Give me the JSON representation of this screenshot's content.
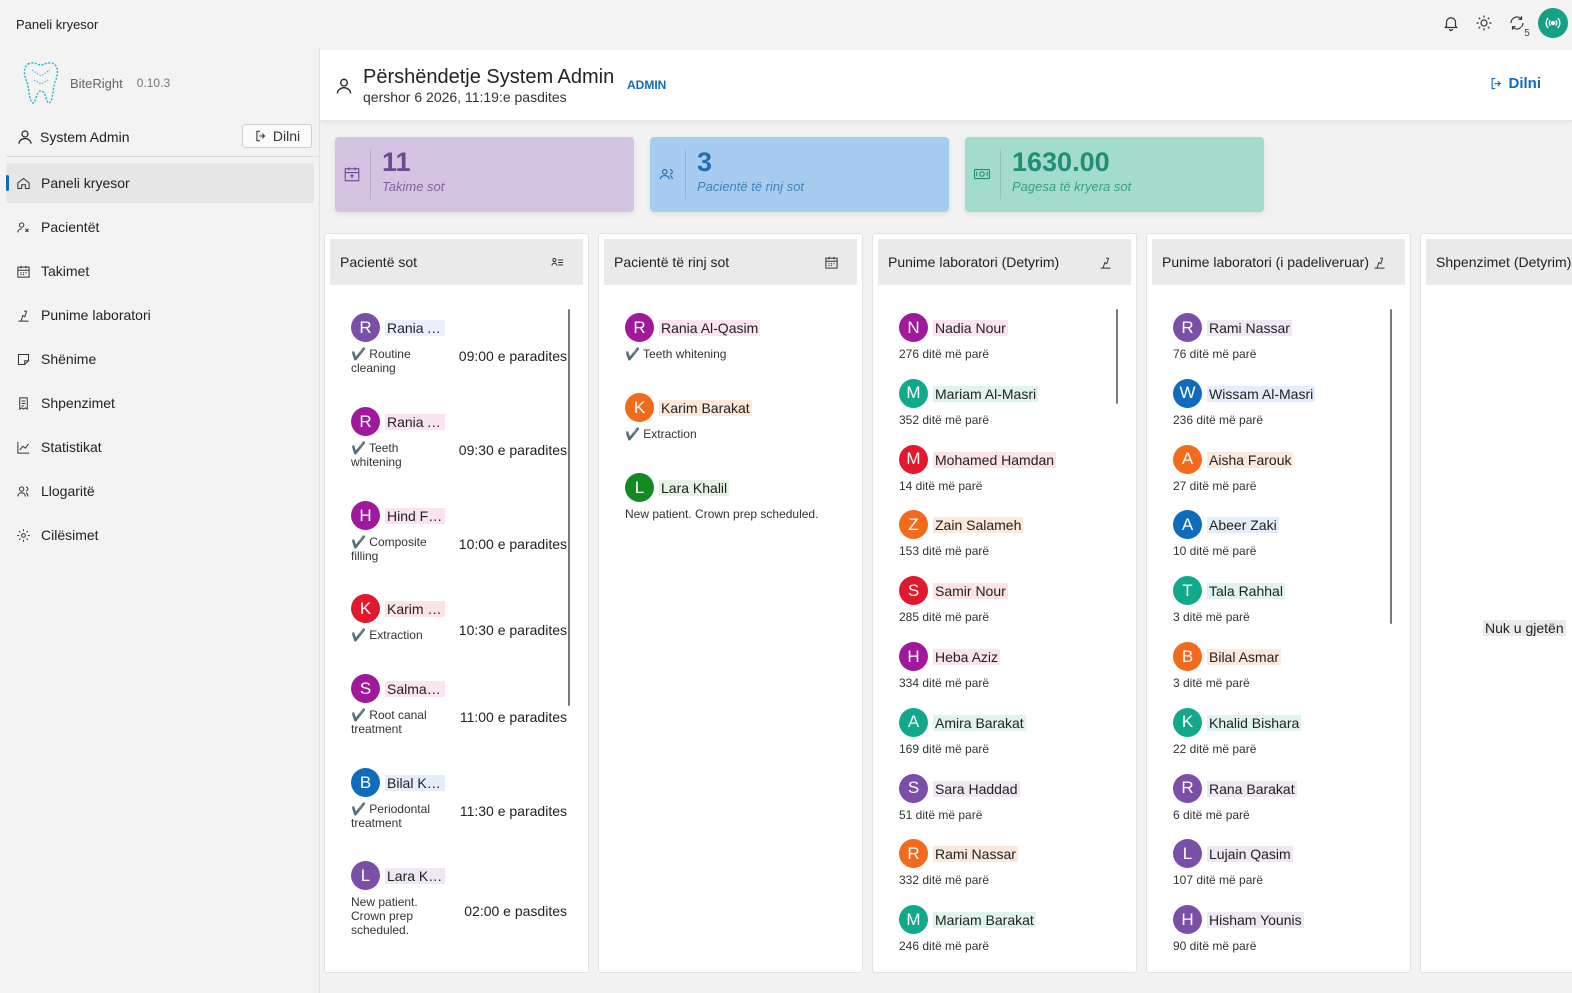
{
  "titlebar": {
    "title": "Paneli kryesor",
    "sync_count": "5"
  },
  "brand": {
    "name": "BiteRight",
    "version": "0.10.3"
  },
  "user": {
    "name": "System Admin",
    "logout_label": "Dilni"
  },
  "nav": [
    {
      "label": "Paneli kryesor",
      "icon": "home-icon",
      "active": true
    },
    {
      "label": "Pacientët",
      "icon": "patients-icon"
    },
    {
      "label": "Takimet",
      "icon": "calendar-icon"
    },
    {
      "label": "Punime laboratori",
      "icon": "lab-icon"
    },
    {
      "label": "Shënime",
      "icon": "note-icon"
    },
    {
      "label": "Shpenzimet",
      "icon": "receipt-icon"
    },
    {
      "label": "Statistikat",
      "icon": "chart-icon"
    },
    {
      "label": "Llogaritë",
      "icon": "accounts-icon"
    },
    {
      "label": "Cilësimet",
      "icon": "settings-icon"
    }
  ],
  "greeting": {
    "heading": "Përshëndetje System Admin",
    "date": "qershor 6 2026, 11:19:e pasdites",
    "role": "ADMIN",
    "logout_label": "Dilni"
  },
  "stats": [
    {
      "value": "11",
      "label": "Takime sot",
      "bg": "#d4c3e3",
      "fg": "#6b4a8f"
    },
    {
      "value": "3",
      "label": "Pacientë të rinj sot",
      "bg": "#a8ccef",
      "fg": "#1f6fb2"
    },
    {
      "value": "1630.00",
      "label": "Pagesa të kryera sot",
      "bg": "#a3dccd",
      "fg": "#1f8f72"
    }
  ],
  "panels": {
    "today": {
      "title": "Pacientë sot",
      "items": [
        {
          "initial": "R",
          "color": "#7b4fa8",
          "name": "Rania A...",
          "note_lines": [
            "✔️ Routine",
            "cleaning"
          ],
          "time": "09:00 e paradites",
          "hl": "#eaf0ff"
        },
        {
          "initial": "R",
          "color": "#a0189b",
          "name": "Rania Al...",
          "note_lines": [
            "✔️ Teeth",
            "whitening"
          ],
          "time": "09:30 e paradites",
          "hl": "#fbe3ef"
        },
        {
          "initial": "H",
          "color": "#a0189b",
          "name": "Hind Fa...",
          "note_lines": [
            "✔️ Composite",
            "filling"
          ],
          "time": "10:00 e paradites",
          "hl": "#fbe3ef"
        },
        {
          "initial": "K",
          "color": "#e0192e",
          "name": "Karim B...",
          "note_lines": [
            "✔️ Extraction"
          ],
          "time": "10:30 e paradites",
          "hl": "#fde3e3"
        },
        {
          "initial": "S",
          "color": "#a0189b",
          "name": "Salma Y...",
          "note_lines": [
            "✔️ Root canal",
            "treatment"
          ],
          "time": "11:00 e paradites",
          "hl": "#fbe3ef"
        },
        {
          "initial": "B",
          "color": "#0f6cbd",
          "name": "Bilal Kh...",
          "note_lines": [
            "✔️ Periodontal",
            "treatment"
          ],
          "time": "11:30 e paradites",
          "hl": "#e4eefb"
        },
        {
          "initial": "L",
          "color": "#7b4fa8",
          "name": "Lara Khalil",
          "note_lines": [
            "New patient.",
            "Crown prep",
            "scheduled."
          ],
          "time": "02:00 e pasdites",
          "hl": "#eee8f5"
        }
      ]
    },
    "new_today": {
      "title": "Pacientë të rinj sot",
      "items": [
        {
          "initial": "R",
          "color": "#a0189b",
          "name": "Rania Al-Qasim",
          "note": "✔️ Teeth whitening",
          "hl": "#fbe3ef"
        },
        {
          "initial": "K",
          "color": "#f26a1b",
          "name": "Karim Barakat",
          "note": "✔️ Extraction",
          "hl": "#fde8dc"
        },
        {
          "initial": "L",
          "color": "#138a21",
          "name": "Lara Khalil",
          "note": "New patient. Crown prep scheduled.",
          "hl": "#e3f3e4"
        }
      ]
    },
    "lab_due": {
      "title": "Punime laboratori (Detyrim)",
      "items": [
        {
          "initial": "N",
          "color": "#a0189b",
          "name": "Nadia Nour",
          "ago": "276 ditë më parë",
          "hl": "#fbe3ef"
        },
        {
          "initial": "M",
          "color": "#10a98a",
          "name": "Mariam Al-Masri",
          "ago": "352 ditë më parë",
          "hl": "#e0f4ef"
        },
        {
          "initial": "M",
          "color": "#e0192e",
          "name": "Mohamed Hamdan",
          "ago": "14 ditë më parë",
          "hl": "#fde3e3"
        },
        {
          "initial": "Z",
          "color": "#f26a1b",
          "name": "Zain Salameh",
          "ago": "153 ditë më parë",
          "hl": "#fde8dc"
        },
        {
          "initial": "S",
          "color": "#e0192e",
          "name": "Samir Nour",
          "ago": "285 ditë më parë",
          "hl": "#fde3e3"
        },
        {
          "initial": "H",
          "color": "#a0189b",
          "name": "Heba Aziz",
          "ago": "334 ditë më parë",
          "hl": "#fbe3ef"
        },
        {
          "initial": "A",
          "color": "#10a98a",
          "name": "Amira Barakat",
          "ago": "169 ditë më parë",
          "hl": "#e0f4ef"
        },
        {
          "initial": "S",
          "color": "#7b4fa8",
          "name": "Sara Haddad",
          "ago": "51 ditë më parë",
          "hl": "#eee8f5"
        },
        {
          "initial": "R",
          "color": "#f26a1b",
          "name": "Rami Nassar",
          "ago": "332 ditë më parë",
          "hl": "#fde8dc"
        },
        {
          "initial": "M",
          "color": "#10a98a",
          "name": "Mariam Barakat",
          "ago": "246 ditë më parë",
          "hl": "#e0f4ef"
        }
      ]
    },
    "lab_undelivered": {
      "title": "Punime laboratori (i padeliveruar)",
      "items": [
        {
          "initial": "R",
          "color": "#7b4fa8",
          "name": "Rami Nassar",
          "ago": "76 ditë më parë",
          "hl": "#eee8f5"
        },
        {
          "initial": "W",
          "color": "#0f6cbd",
          "name": "Wissam Al-Masri",
          "ago": "236 ditë më parë",
          "hl": "#e4eefb"
        },
        {
          "initial": "A",
          "color": "#f26a1b",
          "name": "Aisha Farouk",
          "ago": "27 ditë më parë",
          "hl": "#fde8dc"
        },
        {
          "initial": "A",
          "color": "#0f6cbd",
          "name": "Abeer Zaki",
          "ago": "10 ditë më parë",
          "hl": "#e4eefb"
        },
        {
          "initial": "T",
          "color": "#10a98a",
          "name": "Tala Rahhal",
          "ago": "3 ditë më parë",
          "hl": "#e0f4ef"
        },
        {
          "initial": "B",
          "color": "#f26a1b",
          "name": "Bilal Asmar",
          "ago": "3 ditë më parë",
          "hl": "#fde8dc"
        },
        {
          "initial": "K",
          "color": "#10a98a",
          "name": "Khalid Bishara",
          "ago": "22 ditë më parë",
          "hl": "#e0f4ef"
        },
        {
          "initial": "R",
          "color": "#7b4fa8",
          "name": "Rana Barakat",
          "ago": "6 ditë më parë",
          "hl": "#eee8f5"
        },
        {
          "initial": "L",
          "color": "#7b4fa8",
          "name": "Lujain Qasim",
          "ago": "107 ditë më parë",
          "hl": "#eee8f5"
        },
        {
          "initial": "H",
          "color": "#7b4fa8",
          "name": "Hisham Younis",
          "ago": "90 ditë më parë",
          "hl": "#eee8f5"
        }
      ]
    },
    "expenses_due": {
      "title": "Shpenzimet (Detyrim)",
      "empty_text": "Nuk u gjetën"
    }
  }
}
